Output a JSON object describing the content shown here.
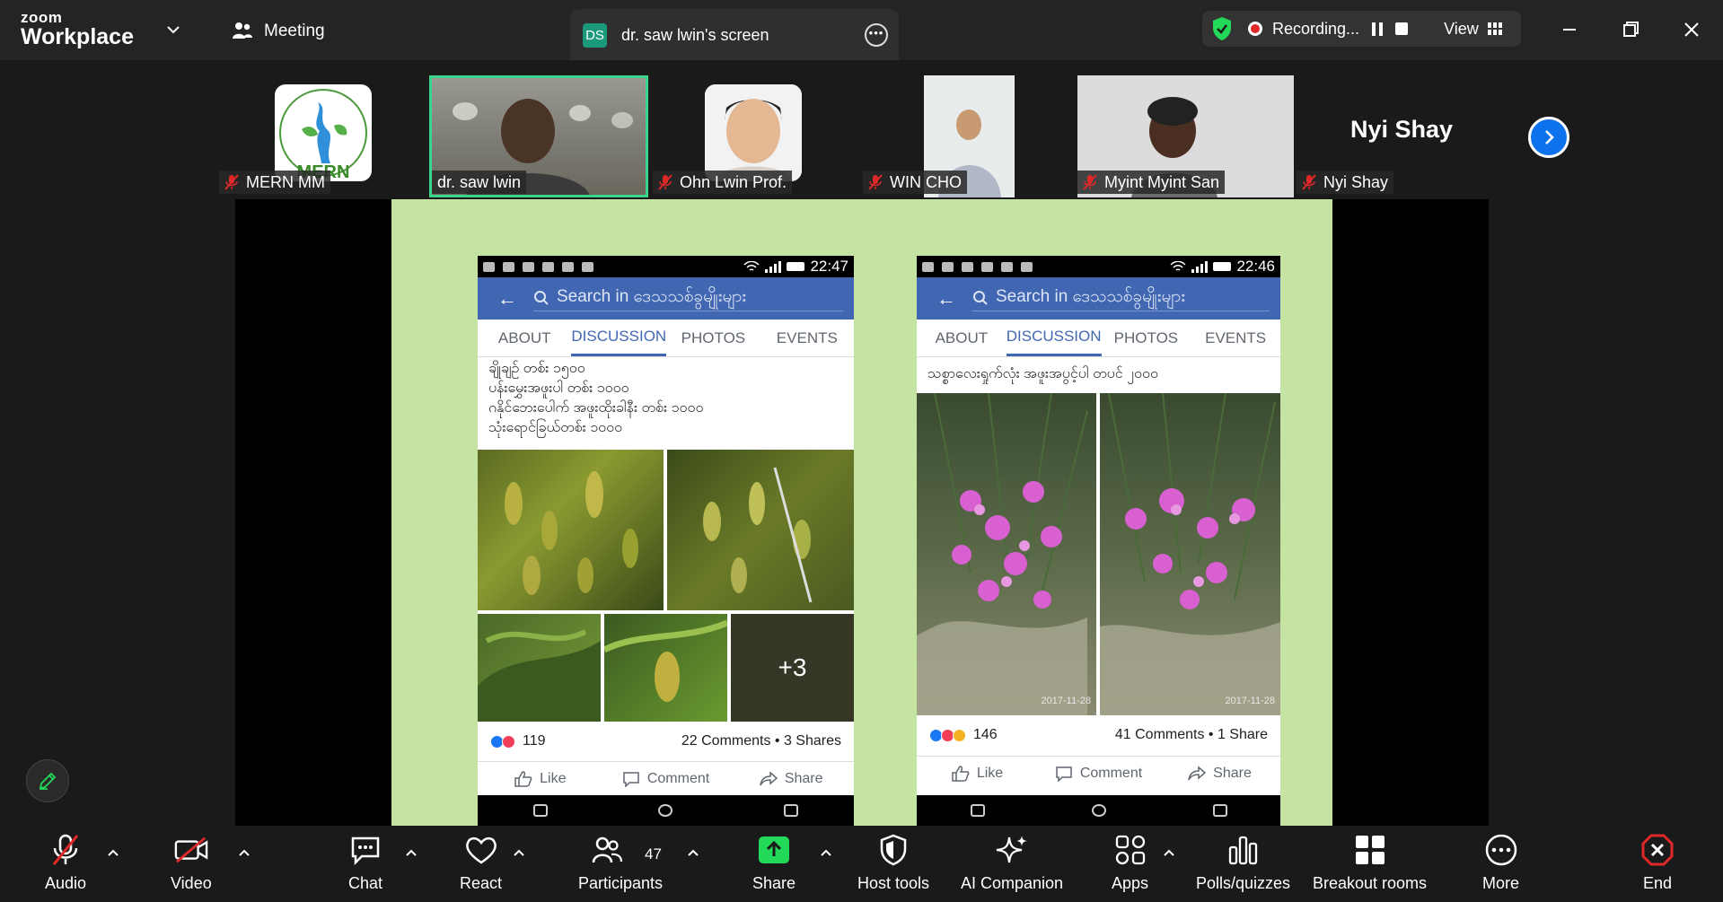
{
  "titlebar": {
    "logo_line1": "zoom",
    "logo_line2": "Workplace",
    "meeting_label": "Meeting",
    "screen_badge": "DS",
    "screen_title": "dr. saw lwin's screen",
    "recording_text": "Recording...",
    "view_label": "View"
  },
  "participants": [
    {
      "name": "MERN MM",
      "muted": true,
      "logo_text": "MERN"
    },
    {
      "name": "dr. saw lwin",
      "muted": false,
      "active": true
    },
    {
      "name": "Ohn Lwin Prof.",
      "muted": true
    },
    {
      "name": "WIN CHO",
      "muted": true
    },
    {
      "name": "Myint Myint San",
      "muted": true
    },
    {
      "name": "Nyi Shay",
      "muted": true,
      "big_name": "Nyi Shay"
    }
  ],
  "phones": [
    {
      "time": "22:47",
      "search": "Search in ဒေသသစ်ခွမျိုးများ",
      "tabs": [
        "ABOUT",
        "DISCUSSION",
        "PHOTOS",
        "EVENTS"
      ],
      "active_tab": 1,
      "post_lines": [
        "ချိုချဉ် တစ်း ၁၅၀၀",
        "ပန်းမွှေးအဖူးပါ တစ်း ၁၀၀၀",
        "ဂနိုင်ဘေးပေါက် အဖူးထိုးခါနီး တစ်း ၁၀၀၀",
        "သုံးရောင်ခြယ်တစ်း ၁၀၀၀"
      ],
      "more_photos": "+3",
      "reactions_count": "119",
      "comments_shares": "22 Comments • 3 Shares",
      "actions": [
        "Like",
        "Comment",
        "Share"
      ]
    },
    {
      "time": "22:46",
      "search": "Search in ဒေသသစ်ခွမျိုးများ",
      "tabs": [
        "ABOUT",
        "DISCUSSION",
        "PHOTOS",
        "EVENTS"
      ],
      "active_tab": 1,
      "post_lines": [
        "သစ္စာလေးရှုက်လုံး အဖူးအပွင့်ပါ တပင် ၂၀၀၀"
      ],
      "date_left": "2017-11-28",
      "date_right": "2017-11-28",
      "reactions_count": "146",
      "comments_shares": "41 Comments • 1 Share",
      "actions": [
        "Like",
        "Comment",
        "Share"
      ]
    }
  ],
  "toolbar": {
    "audio": "Audio",
    "video": "Video",
    "chat": "Chat",
    "react": "React",
    "participants": "Participants",
    "participants_count": "47",
    "share": "Share",
    "host_tools": "Host tools",
    "ai_companion": "AI Companion",
    "apps": "Apps",
    "polls": "Polls/quizzes",
    "breakout": "Breakout rooms",
    "more": "More",
    "end": "End"
  },
  "colors": {
    "background": "#1a1a1a",
    "zoom_blue": "#0e72ed",
    "share_green": "#23d959",
    "active_speaker": "#3bd48c",
    "end_red": "#e02828",
    "slide_green": "#c5e3a2",
    "facebook_blue": "#4267b2"
  }
}
